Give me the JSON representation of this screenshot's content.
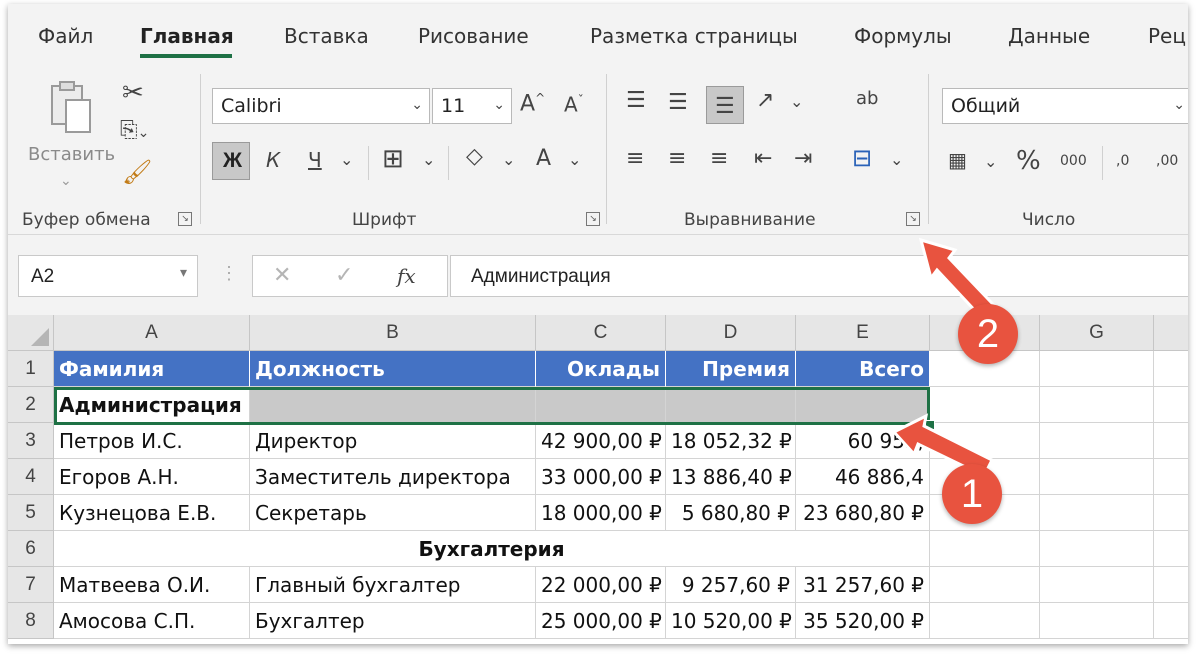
{
  "tabs": [
    "Файл",
    "Главная",
    "Вставка",
    "Рисование",
    "Разметка страницы",
    "Формулы",
    "Данные",
    "Рец"
  ],
  "active_tab": "Главная",
  "ribbon": {
    "clipboard": {
      "label": "Буфер обмена",
      "paste_label": "Вставить"
    },
    "font": {
      "label": "Шрифт",
      "font_name": "Calibri",
      "font_size": "11",
      "bold": "Ж",
      "italic": "К",
      "underline": "Ч",
      "grow": "A",
      "shrink": "A",
      "color": "A"
    },
    "alignment": {
      "label": "Выравнивание",
      "wrap": "ab"
    },
    "number": {
      "label": "Число",
      "format": "Общий",
      "percent": "%",
      "thousands": "000",
      "inc_decimal": ",0",
      "dec_decimal": ",00"
    }
  },
  "formula_bar": {
    "name_box": "A2",
    "fx": "fx",
    "value": "Администрация"
  },
  "columns": [
    "A",
    "B",
    "C",
    "D",
    "E",
    "",
    "G"
  ],
  "rows": [
    {
      "n": "1",
      "cells": [
        "Фамилия",
        "Должность",
        "Оклады",
        "Премия",
        "Всего"
      ]
    },
    {
      "n": "2",
      "cells": [
        "Администрация",
        "",
        "",
        "",
        ""
      ]
    },
    {
      "n": "3",
      "cells": [
        "Петров И.С.",
        "Директор",
        "42 900,00 ₽",
        "18 052,32 ₽",
        "60 952,"
      ]
    },
    {
      "n": "4",
      "cells": [
        "Егоров А.Н.",
        "Заместитель директора",
        "33 000,00 ₽",
        "13 886,40 ₽",
        "46 886,4"
      ]
    },
    {
      "n": "5",
      "cells": [
        "Кузнецова Е.В.",
        "Секретарь",
        "18 000,00 ₽",
        "5 680,80 ₽",
        "23 680,80 ₽"
      ]
    },
    {
      "n": "6",
      "cells": [
        "Бухгалтерия"
      ]
    },
    {
      "n": "7",
      "cells": [
        "Матвеева О.И.",
        "Главный бухгалтер",
        "22 000,00 ₽",
        "9 257,60 ₽",
        "31 257,60 ₽"
      ]
    },
    {
      "n": "8",
      "cells": [
        "Амосова С.П.",
        "Бухгалтер",
        "25 000,00 ₽",
        "10 520,00 ₽",
        "35 520,00 ₽"
      ]
    }
  ],
  "callouts": [
    "1",
    "2"
  ],
  "colors": {
    "accent": "#1e7145",
    "header_fill": "#4472c4",
    "selection_fill": "#c9c9c9",
    "callout": "#e8533f"
  }
}
